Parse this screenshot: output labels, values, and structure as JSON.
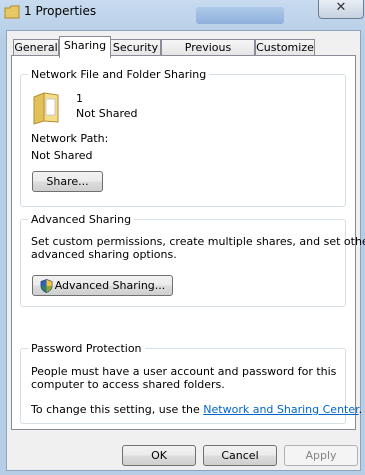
{
  "window": {
    "title": "1 Properties",
    "close_glyph": "✕",
    "folder_icon": "folder-icon"
  },
  "tabs": [
    {
      "label": "General",
      "active": false
    },
    {
      "label": "Sharing",
      "active": true
    },
    {
      "label": "Security",
      "active": false
    },
    {
      "label": "Previous Versions",
      "active": false
    },
    {
      "label": "Customize",
      "active": false
    }
  ],
  "network_sharing": {
    "title": "Network File and Folder Sharing",
    "folder_name": "1",
    "folder_status": "Not Shared",
    "network_path_label": "Network Path:",
    "network_path_value": "Not Shared",
    "share_button": "Share..."
  },
  "advanced_sharing": {
    "title": "Advanced Sharing",
    "description_line1": "Set custom permissions, create multiple shares, and set other",
    "description_line2": "advanced sharing options.",
    "button": "Advanced Sharing...",
    "button_icon": "uac-shield-icon"
  },
  "password_protection": {
    "title": "Password Protection",
    "line1": "People must have a user account and password for this",
    "line2": "computer to access shared folders.",
    "change_prefix": "To change this setting, use the",
    "link": "Network and Sharing Center",
    "suffix": "."
  },
  "footer": {
    "ok": "OK",
    "cancel": "Cancel",
    "apply": "Apply",
    "apply_enabled": false
  },
  "colors": {
    "link": "#0066cc",
    "window_frame": "#b6cde6"
  }
}
